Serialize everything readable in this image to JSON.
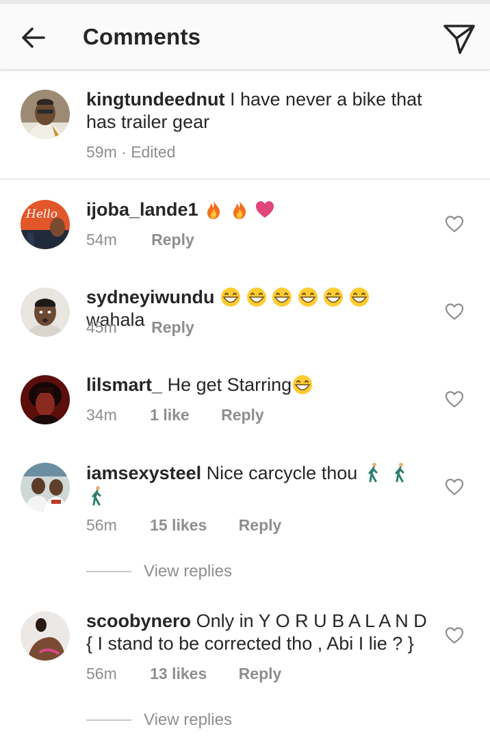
{
  "header": {
    "title": "Comments",
    "back_icon": "arrow-left-icon",
    "share_icon": "send-icon"
  },
  "caption": {
    "username": "kingtundeednut",
    "text": "I have never a bike that has trailer gear",
    "time": "59m",
    "edited": "· Edited"
  },
  "comments": [
    {
      "username": "ijoba_lande1",
      "text": "",
      "emojis": [
        "fire",
        "fire",
        "heart"
      ],
      "time": "54m",
      "likes": "",
      "reply": "Reply"
    },
    {
      "username": "sydneyiwundu",
      "text": "wahala",
      "emojis": [
        "grin",
        "grin",
        "grin",
        "grin",
        "grin",
        "grin"
      ],
      "time": "45m",
      "likes": "",
      "reply": "Reply"
    },
    {
      "username": "lilsmart_",
      "text": "He get Starring",
      "emojis_after": [
        "grin"
      ],
      "time": "34m",
      "likes": "1 like",
      "reply": "Reply"
    },
    {
      "username": "iamsexysteel",
      "text": "Nice carcycle thou",
      "emojis_after": [
        "walk",
        "walk",
        "walk"
      ],
      "time": "56m",
      "likes": "15 likes",
      "reply": "Reply",
      "view_replies": "View replies"
    },
    {
      "username": "scoobynero",
      "text": "Only in Y O R U B A  L A N D { I stand to be corrected tho , Abi I lie ? }",
      "time": "56m",
      "likes": "13 likes",
      "reply": "Reply",
      "view_replies": "View replies"
    }
  ],
  "colors": {
    "text": "#262626",
    "secondary": "#8e8e8e",
    "divider": "#dbdbdb",
    "heart_emoji": "#e0457b",
    "fire": "#f36f21"
  }
}
